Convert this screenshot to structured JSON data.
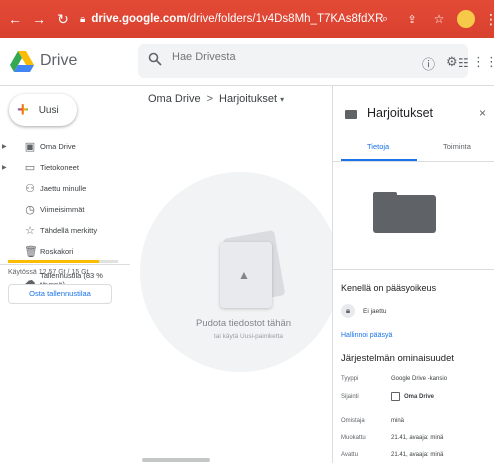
{
  "browser": {
    "url_domain": "drive.google.com",
    "url_path": "/drive/folders/1v4Ds8Mh_T7KAs8fdXRR7fYe_n3Dxb..."
  },
  "header": {
    "app_name": "Drive",
    "search_placeholder": "Hae Drivesta"
  },
  "sidebar": {
    "new_label": "Uusi",
    "items": [
      {
        "label": "Oma Drive",
        "icon": "drive-icon"
      },
      {
        "label": "Tietokoneet",
        "icon": "computer-icon"
      },
      {
        "label": "Jaettu minulle",
        "icon": "shared-icon"
      },
      {
        "label": "Viimeisimmät",
        "icon": "clock-icon"
      },
      {
        "label": "Tähdellä merkitty",
        "icon": "star-icon"
      },
      {
        "label": "Roskakori",
        "icon": "trash-icon"
      },
      {
        "label": "Tallennustila (83 % täynnä)",
        "icon": "cloud-icon"
      }
    ],
    "storage_fraction": 0.83,
    "storage_text": "Käytössä 12,57 Gt / 15 Gt",
    "buy_storage": "Osta tallennustilaa"
  },
  "main": {
    "breadcrumb_root": "Oma Drive",
    "breadcrumb_sep": ">",
    "breadcrumb_current": "Harjoitukset",
    "drop_title": "Pudota tiedostot tähän",
    "drop_subtitle": "tai käytä Uusi-painiketta"
  },
  "details": {
    "title": "Harjoitukset",
    "close": "×",
    "tabs": [
      {
        "label": "Tietoja",
        "active": true
      },
      {
        "label": "Toiminta",
        "active": false
      }
    ],
    "access_title": "Kenellä on pääsyoikeus",
    "not_shared": "Ei jaettu",
    "manage_access": "Hallinnoi pääsyä",
    "props_title": "Järjestelmän ominaisuudet",
    "properties": [
      {
        "label": "Tyyppi",
        "value": "Google Drive -kansio"
      },
      {
        "label": "Sijainti",
        "value": "Oma Drive"
      },
      {
        "label": "Omistaja",
        "value": "minä"
      },
      {
        "label": "Muokattu",
        "value": "21.41, avaaja: minä"
      },
      {
        "label": "Avattu",
        "value": "21.41, avaaja: minä"
      }
    ]
  },
  "colors": {
    "browser_bar": "#e0432f",
    "accent": "#1a73e8",
    "storage": "#fbbc04"
  }
}
